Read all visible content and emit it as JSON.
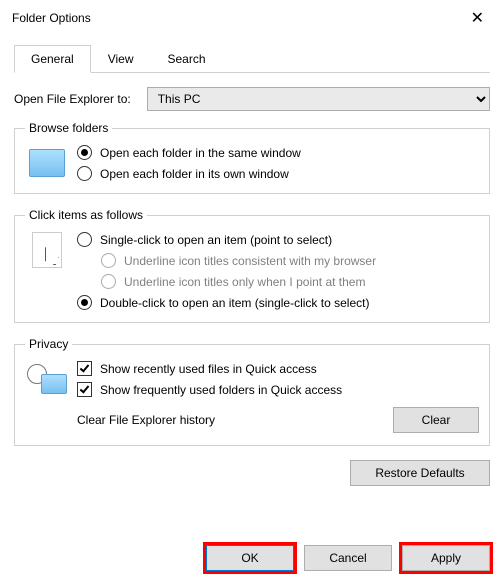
{
  "window": {
    "title": "Folder Options"
  },
  "tabs": {
    "general": "General",
    "view": "View",
    "search": "Search"
  },
  "openExplorer": {
    "label": "Open File Explorer to:",
    "value": "This PC"
  },
  "browse": {
    "legend": "Browse folders",
    "same": "Open each folder in the same window",
    "own": "Open each folder in its own window"
  },
  "click": {
    "legend": "Click items as follows",
    "single": "Single-click to open an item (point to select)",
    "ul_browser": "Underline icon titles consistent with my browser",
    "ul_point": "Underline icon titles only when I point at them",
    "double": "Double-click to open an item (single-click to select)"
  },
  "privacy": {
    "legend": "Privacy",
    "recent": "Show recently used files in Quick access",
    "frequent": "Show frequently used folders in Quick access",
    "clear_label": "Clear File Explorer history",
    "clear_btn": "Clear"
  },
  "buttons": {
    "restore": "Restore Defaults",
    "ok": "OK",
    "cancel": "Cancel",
    "apply": "Apply"
  }
}
